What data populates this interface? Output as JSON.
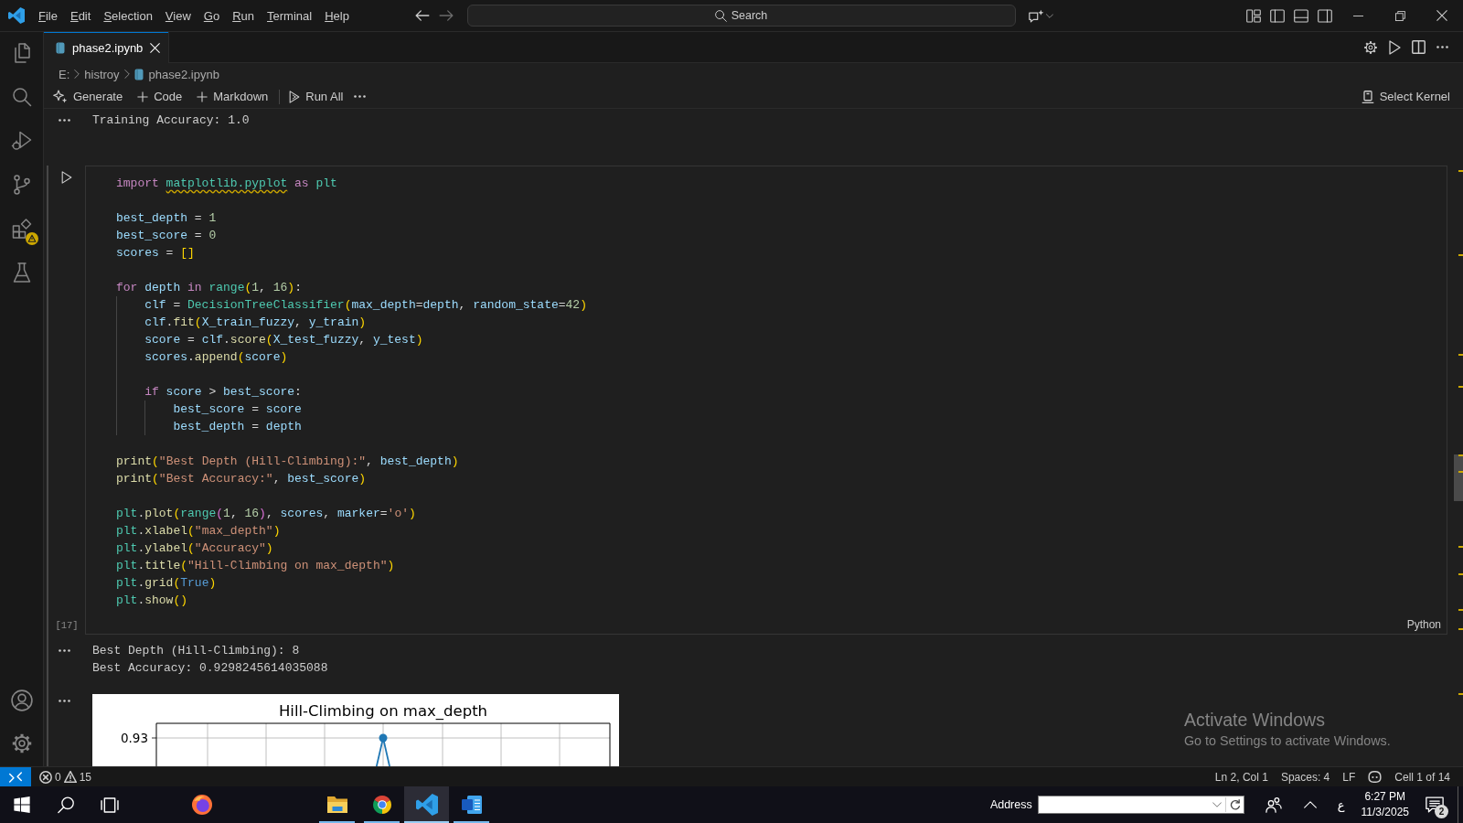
{
  "title_bar": {
    "menu": [
      {
        "label": "File"
      },
      {
        "label": "Edit"
      },
      {
        "label": "Selection"
      },
      {
        "label": "View"
      },
      {
        "label": "Go"
      },
      {
        "label": "Run"
      },
      {
        "label": "Terminal"
      },
      {
        "label": "Help"
      }
    ],
    "command_center": {
      "label": "Search"
    }
  },
  "tabs": [
    {
      "label": "phase2.ipynb",
      "selected": true
    }
  ],
  "breadcrumb": [
    {
      "label": "E:",
      "kind": "folder"
    },
    {
      "label": "histroy",
      "kind": "folder"
    },
    {
      "label": "phase2.ipynb",
      "kind": "notebook"
    }
  ],
  "notebook_toolbar": {
    "actions": [
      {
        "label": "Generate",
        "kind": "generate"
      },
      {
        "label": "Code",
        "kind": "add"
      },
      {
        "label": "Markdown",
        "kind": "add"
      },
      {
        "label": "Run All",
        "kind": "run"
      }
    ],
    "kernel": {
      "label": "Select Kernel"
    }
  },
  "cells": [
    {
      "selected": false,
      "outputs": [
        {
          "kind": "text",
          "lines": [
            "Training Accuracy: 1.0"
          ]
        }
      ]
    },
    {
      "selected": true,
      "execution_count": "[17]",
      "language": "Python",
      "code": [
        {
          "lines": [
            [
              {
                "text": "import ",
                "kind": "keyword"
              },
              {
                "text": "matplotlib.pyplot",
                "kind": "unresolved"
              },
              {
                "text": " as ",
                "kind": "keyword"
              },
              {
                "text": "plt",
                "kind": "module"
              }
            ]
          ]
        },
        {
          "lines": [
            [
              {
                "text": "best_depth",
                "kind": "variable"
              },
              {
                "text": " = ",
                "kind": "operator"
              },
              {
                "text": "1",
                "kind": "number"
              }
            ],
            [
              {
                "text": "best_score",
                "kind": "variable"
              },
              {
                "text": " = ",
                "kind": "operator"
              },
              {
                "text": "0",
                "kind": "number"
              }
            ],
            [
              {
                "text": "scores",
                "kind": "variable"
              },
              {
                "text": " = ",
                "kind": "operator"
              },
              {
                "text": "[]",
                "kind": "bracket"
              }
            ]
          ]
        },
        {
          "lines": [
            [
              {
                "text": "for ",
                "kind": "keyword"
              },
              {
                "text": "depth",
                "kind": "variable"
              },
              {
                "text": " in ",
                "kind": "keyword"
              },
              {
                "text": "range",
                "kind": "class"
              },
              {
                "text": "(",
                "kind": "bracket"
              },
              {
                "text": "1",
                "kind": "number"
              },
              {
                "text": ", ",
                "kind": "operator"
              },
              {
                "text": "16",
                "kind": "number"
              },
              {
                "text": ")",
                "kind": "bracket"
              },
              {
                "text": ":",
                "kind": "operator"
              }
            ],
            [
              {
                "text": "    clf",
                "kind": "variable"
              },
              {
                "text": " = ",
                "kind": "operator"
              },
              {
                "text": "DecisionTreeClassifier",
                "kind": "class"
              },
              {
                "text": "(",
                "kind": "bracket"
              },
              {
                "text": "max_depth",
                "kind": "variable"
              },
              {
                "text": "=",
                "kind": "operator"
              },
              {
                "text": "depth",
                "kind": "variable"
              },
              {
                "text": ", ",
                "kind": "operator"
              },
              {
                "text": "random_state",
                "kind": "variable"
              },
              {
                "text": "=",
                "kind": "operator"
              },
              {
                "text": "42",
                "kind": "number"
              },
              {
                "text": ")",
                "kind": "bracket"
              }
            ],
            [
              {
                "text": "    clf",
                "kind": "variable"
              },
              {
                "text": ".",
                "kind": "operator"
              },
              {
                "text": "fit",
                "kind": "function"
              },
              {
                "text": "(",
                "kind": "bracket"
              },
              {
                "text": "X_train_fuzzy",
                "kind": "variable"
              },
              {
                "text": ", ",
                "kind": "operator"
              },
              {
                "text": "y_train",
                "kind": "variable"
              },
              {
                "text": ")",
                "kind": "bracket"
              }
            ],
            [
              {
                "text": "    score",
                "kind": "variable"
              },
              {
                "text": " = ",
                "kind": "operator"
              },
              {
                "text": "clf",
                "kind": "variable"
              },
              {
                "text": ".",
                "kind": "operator"
              },
              {
                "text": "score",
                "kind": "function"
              },
              {
                "text": "(",
                "kind": "bracket"
              },
              {
                "text": "X_test_fuzzy",
                "kind": "variable"
              },
              {
                "text": ", ",
                "kind": "operator"
              },
              {
                "text": "y_test",
                "kind": "variable"
              },
              {
                "text": ")",
                "kind": "bracket"
              }
            ],
            [
              {
                "text": "    scores",
                "kind": "variable"
              },
              {
                "text": ".",
                "kind": "operator"
              },
              {
                "text": "append",
                "kind": "function"
              },
              {
                "text": "(",
                "kind": "bracket"
              },
              {
                "text": "score",
                "kind": "variable"
              },
              {
                "text": ")",
                "kind": "bracket"
              }
            ]
          ]
        },
        {
          "lines": [
            [
              {
                "text": "    if ",
                "kind": "keyword"
              },
              {
                "text": "score",
                "kind": "variable"
              },
              {
                "text": " > ",
                "kind": "operator"
              },
              {
                "text": "best_score",
                "kind": "variable"
              },
              {
                "text": ":",
                "kind": "operator"
              }
            ],
            [
              {
                "text": "        best_score",
                "kind": "variable"
              },
              {
                "text": " = ",
                "kind": "operator"
              },
              {
                "text": "score",
                "kind": "variable"
              }
            ],
            [
              {
                "text": "        best_depth",
                "kind": "variable"
              },
              {
                "text": " = ",
                "kind": "operator"
              },
              {
                "text": "depth",
                "kind": "variable"
              }
            ]
          ]
        },
        {
          "lines": [
            [
              {
                "text": "print",
                "kind": "function"
              },
              {
                "text": "(",
                "kind": "bracket"
              },
              {
                "text": "\"Best Depth (Hill-Climbing):\"",
                "kind": "string"
              },
              {
                "text": ", ",
                "kind": "operator"
              },
              {
                "text": "best_depth",
                "kind": "variable"
              },
              {
                "text": ")",
                "kind": "bracket"
              }
            ],
            [
              {
                "text": "print",
                "kind": "function"
              },
              {
                "text": "(",
                "kind": "bracket"
              },
              {
                "text": "\"Best Accuracy:\"",
                "kind": "string"
              },
              {
                "text": ", ",
                "kind": "operator"
              },
              {
                "text": "best_score",
                "kind": "variable"
              },
              {
                "text": ")",
                "kind": "bracket"
              }
            ]
          ]
        },
        {
          "lines": [
            [
              {
                "text": "plt",
                "kind": "module"
              },
              {
                "text": ".",
                "kind": "operator"
              },
              {
                "text": "plot",
                "kind": "function"
              },
              {
                "text": "(",
                "kind": "bracket"
              },
              {
                "text": "range",
                "kind": "class"
              },
              {
                "text": "(",
                "kind": "bracket2"
              },
              {
                "text": "1",
                "kind": "number"
              },
              {
                "text": ", ",
                "kind": "operator"
              },
              {
                "text": "16",
                "kind": "number"
              },
              {
                "text": ")",
                "kind": "bracket2"
              },
              {
                "text": ", ",
                "kind": "operator"
              },
              {
                "text": "scores",
                "kind": "variable"
              },
              {
                "text": ", ",
                "kind": "operator"
              },
              {
                "text": "marker",
                "kind": "variable"
              },
              {
                "text": "=",
                "kind": "operator"
              },
              {
                "text": "'o'",
                "kind": "string"
              },
              {
                "text": ")",
                "kind": "bracket"
              }
            ],
            [
              {
                "text": "plt",
                "kind": "module"
              },
              {
                "text": ".",
                "kind": "operator"
              },
              {
                "text": "xlabel",
                "kind": "function"
              },
              {
                "text": "(",
                "kind": "bracket"
              },
              {
                "text": "\"max_depth\"",
                "kind": "string"
              },
              {
                "text": ")",
                "kind": "bracket"
              }
            ],
            [
              {
                "text": "plt",
                "kind": "module"
              },
              {
                "text": ".",
                "kind": "operator"
              },
              {
                "text": "ylabel",
                "kind": "function"
              },
              {
                "text": "(",
                "kind": "bracket"
              },
              {
                "text": "\"Accuracy\"",
                "kind": "string"
              },
              {
                "text": ")",
                "kind": "bracket"
              }
            ],
            [
              {
                "text": "plt",
                "kind": "module"
              },
              {
                "text": ".",
                "kind": "operator"
              },
              {
                "text": "title",
                "kind": "function"
              },
              {
                "text": "(",
                "kind": "bracket"
              },
              {
                "text": "\"Hill-Climbing on max_depth\"",
                "kind": "string"
              },
              {
                "text": ")",
                "kind": "bracket"
              }
            ],
            [
              {
                "text": "plt",
                "kind": "module"
              },
              {
                "text": ".",
                "kind": "operator"
              },
              {
                "text": "grid",
                "kind": "function"
              },
              {
                "text": "(",
                "kind": "bracket"
              },
              {
                "text": "True",
                "kind": "constant"
              },
              {
                "text": ")",
                "kind": "bracket"
              }
            ],
            [
              {
                "text": "plt",
                "kind": "module"
              },
              {
                "text": ".",
                "kind": "operator"
              },
              {
                "text": "show",
                "kind": "function"
              },
              {
                "text": "()",
                "kind": "bracket"
              }
            ]
          ]
        }
      ],
      "outputs": [
        {
          "kind": "text",
          "lines": [
            "Best Depth (Hill-Climbing): 8",
            "Best Accuracy: 0.9298245614035088"
          ]
        },
        {
          "kind": "plot",
          "title": "Hill-Climbing on max_depth",
          "ytick_labels": [
            "0.93"
          ]
        }
      ]
    }
  ],
  "status_bar": {
    "errors": "0",
    "warnings": "15",
    "items": [
      {
        "kind": "text",
        "label": "Ln 2, Col 1"
      },
      {
        "kind": "text",
        "label": "Spaces: 4"
      },
      {
        "kind": "text",
        "label": "LF"
      },
      {
        "kind": "assistant"
      },
      {
        "kind": "text",
        "label": "Cell 1 of 14"
      }
    ]
  },
  "activation_notice": {
    "title": "Activate Windows",
    "text": "Go to Settings to activate Windows."
  },
  "taskbar": {
    "apps": [
      {
        "running": false,
        "selected": false
      },
      {
        "running": true,
        "selected": false
      },
      {
        "running": true,
        "selected": false
      },
      {
        "running": true,
        "selected": true
      },
      {
        "running": true,
        "selected": false
      }
    ],
    "address": {
      "label": "Address"
    },
    "tray": {
      "language": "ع",
      "time": "6:27 PM",
      "date": "11/3/2025",
      "notification_count": "2"
    }
  }
}
